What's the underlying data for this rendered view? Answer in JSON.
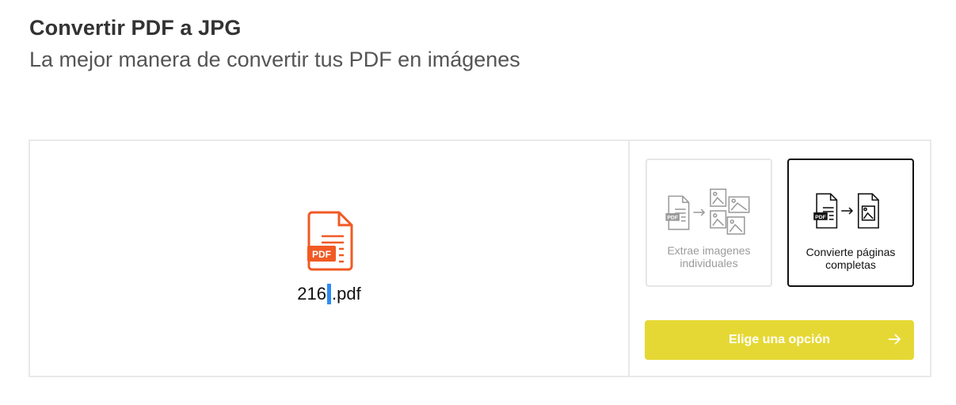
{
  "header": {
    "title": "Convertir PDF a JPG",
    "subtitle": "La mejor manera de convertir tus PDF en imágenes"
  },
  "file": {
    "name_part1": "216",
    "name_part2": ".pdf",
    "badge": "PDF",
    "icon": "pdf-file-icon"
  },
  "options": [
    {
      "label": "Extrae imagenes individuales",
      "icon": "extract-images-icon",
      "selected": false
    },
    {
      "label": "Convierte páginas completas",
      "icon": "convert-pages-icon",
      "selected": true
    }
  ],
  "action": {
    "label": "Elige una opción",
    "icon": "arrow-right-icon"
  },
  "colors": {
    "accent": "#e6d834",
    "pdf": "#f15a24",
    "cursor": "#2d8cf0"
  }
}
